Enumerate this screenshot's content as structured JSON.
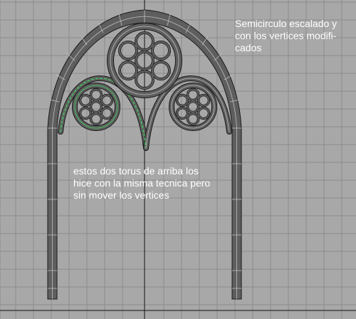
{
  "viewport": {
    "background_color": "#a8a8a8",
    "grid_color": "#8c8c8c",
    "axis_color": "#111111",
    "model_color": "#5e5e5e",
    "model_outline_color": "#1a1a1a",
    "wire_color": "#bfbfbf",
    "selected_wire_color": "#3cd25f",
    "annotation_color": "#ffffff"
  },
  "annotations": {
    "top_note": {
      "lines": [
        "Semicirculo escalado y",
        "con los vertices modifi-",
        "cados"
      ]
    },
    "middle_note": {
      "lines": [
        "estos dos torus de arriba los",
        "hice con la misma tecnica pero",
        "sin mover los vertices"
      ]
    }
  }
}
